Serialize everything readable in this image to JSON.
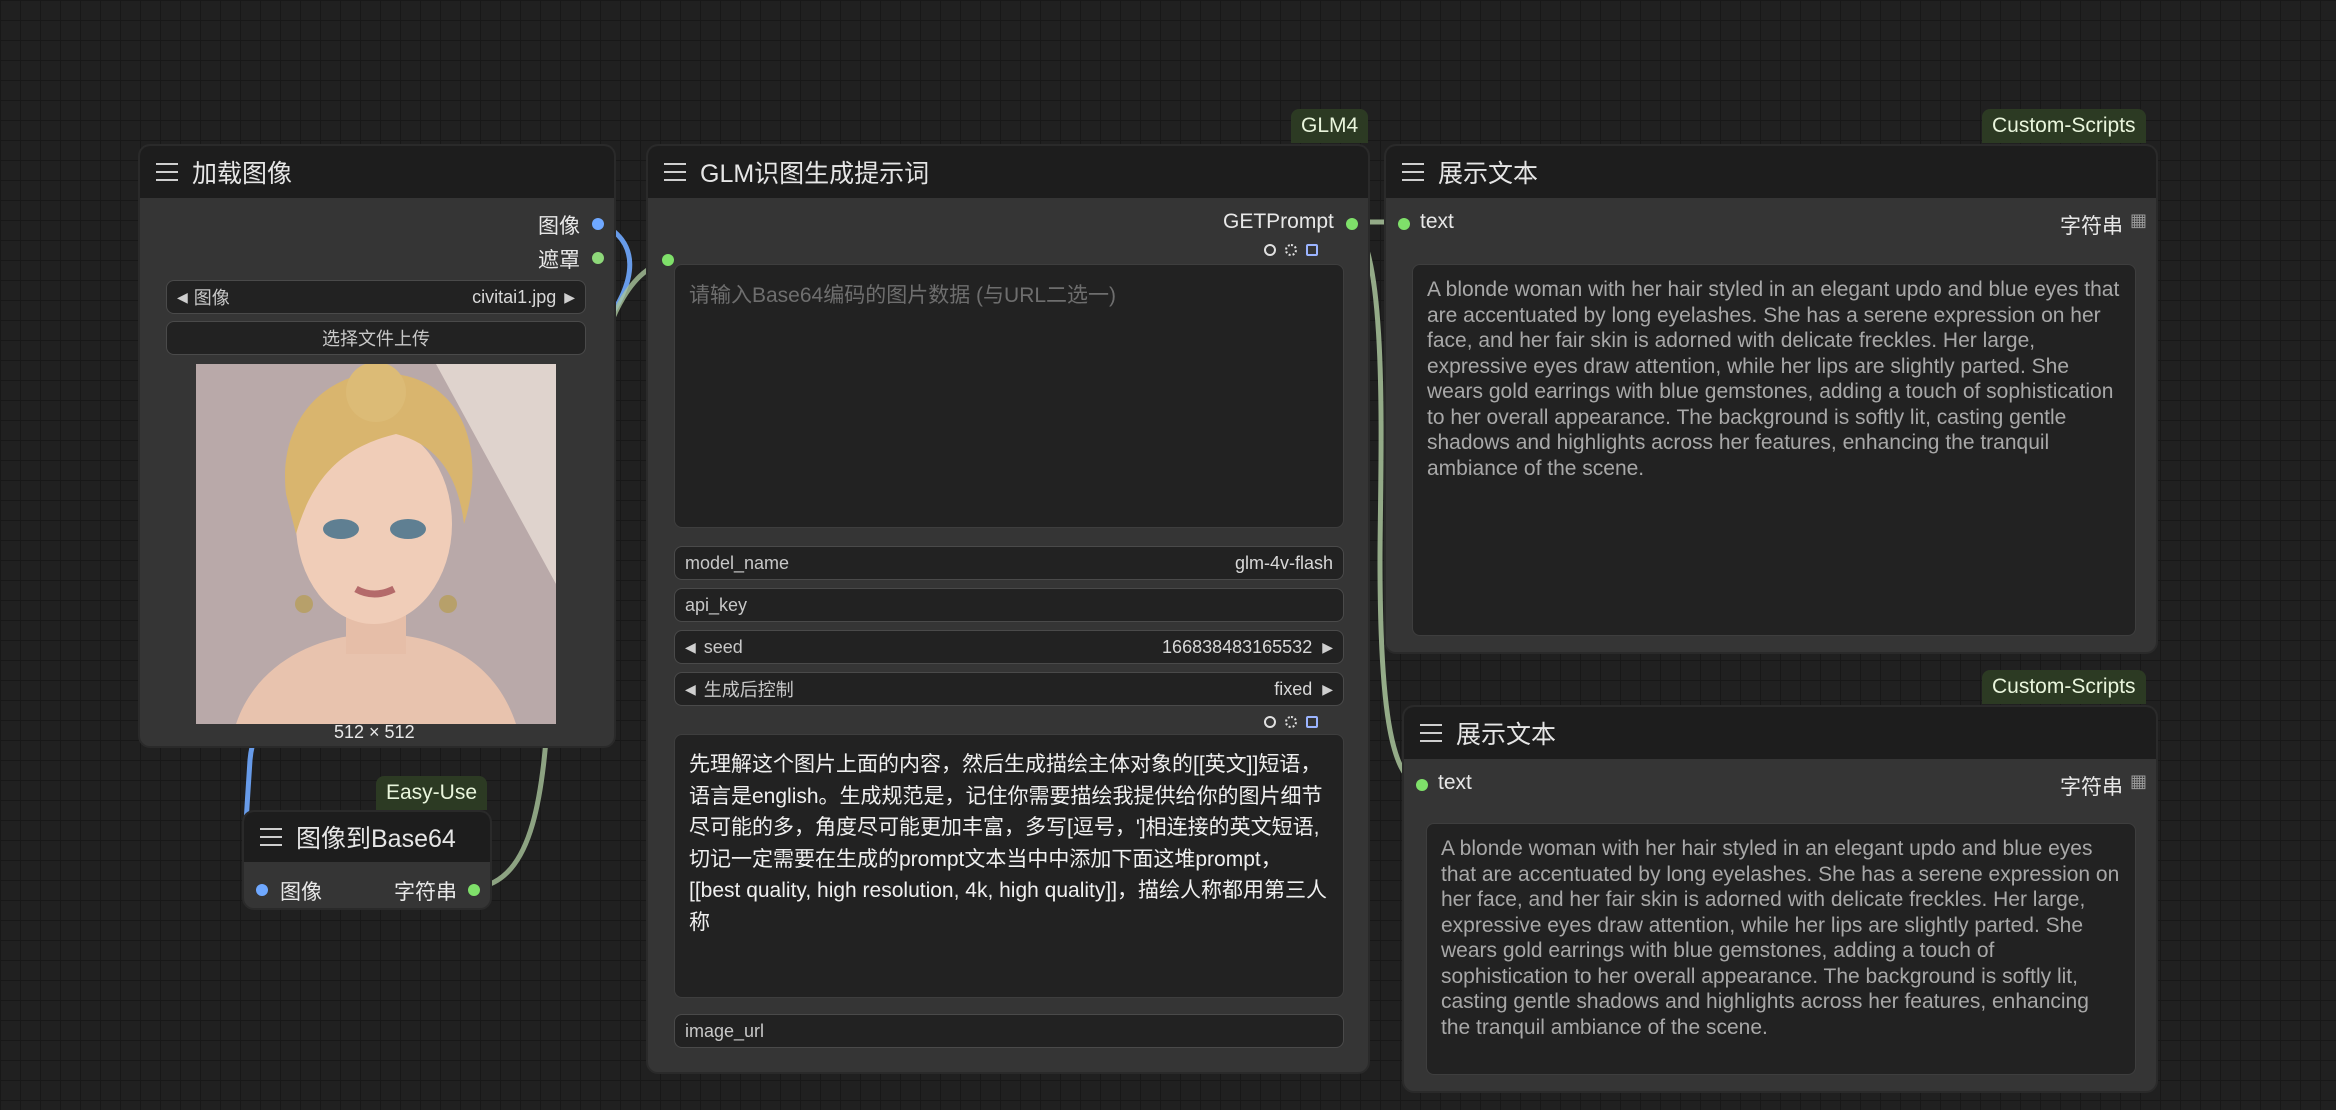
{
  "badges": {
    "glm4": "GLM4",
    "custom1": "Custom-Scripts",
    "custom2": "Custom-Scripts",
    "easyuse": "Easy-Use"
  },
  "load_image": {
    "title": "加载图像",
    "output_image": "图像",
    "output_mask": "遮罩",
    "image_widget": {
      "label": "图像",
      "value": "civitai1.jpg"
    },
    "upload_button": "选择文件上传",
    "size_text": "512 × 512"
  },
  "glm": {
    "title": "GLM识图生成提示词",
    "output": "GETPrompt",
    "base64_placeholder": "请输入Base64编码的图片数据 (与URL二选一)",
    "model_name": {
      "label": "model_name",
      "value": "glm-4v-flash"
    },
    "api_key": {
      "label": "api_key",
      "value": ""
    },
    "seed": {
      "label": "seed",
      "value": "166838483165532"
    },
    "control": {
      "label": "生成后控制",
      "value": "fixed"
    },
    "prompt": "先理解这个图片上面的内容，然后生成描绘主体对象的[[英文]]短语，语言是english。生成规范是，记住你需要描绘我提供给你的图片细节尽可能的多，角度尽可能更加丰富，多写[逗号，']相连接的英文短语,切记一定需要在生成的prompt文本当中中添加下面这堆prompt，[[best quality, high resolution, 4k, high quality]]，描绘人称都用第三人称",
    "image_url": "image_url"
  },
  "show_text_1": {
    "title": "展示文本",
    "input": "text",
    "output": "字符串",
    "content": "A blonde woman with her hair styled in an elegant updo and blue eyes that are accentuated by long eyelashes. She has a serene expression on her face, and her fair skin is adorned with delicate freckles. Her large, expressive eyes draw attention, while her lips are slightly parted. She wears gold earrings with blue gemstones, adding a touch of sophistication to her overall appearance. The background is softly lit, casting gentle shadows and highlights across her features, enhancing the tranquil ambiance of the scene."
  },
  "show_text_2": {
    "title": "展示文本",
    "input": "text",
    "output": "字符串",
    "content": "A blonde woman with her hair styled in an elegant updo and blue eyes that are accentuated by long eyelashes. She has a serene expression on her face, and her fair skin is adorned with delicate freckles. Her large, expressive eyes draw attention, while her lips are slightly parted. She wears gold earrings with blue gemstones, adding a touch of sophistication to her overall appearance. The background is softly lit, casting gentle shadows and highlights across her features, enhancing the tranquil ambiance of the scene."
  },
  "to_base64": {
    "title": "图像到Base64",
    "input": "图像",
    "output": "字符串"
  }
}
